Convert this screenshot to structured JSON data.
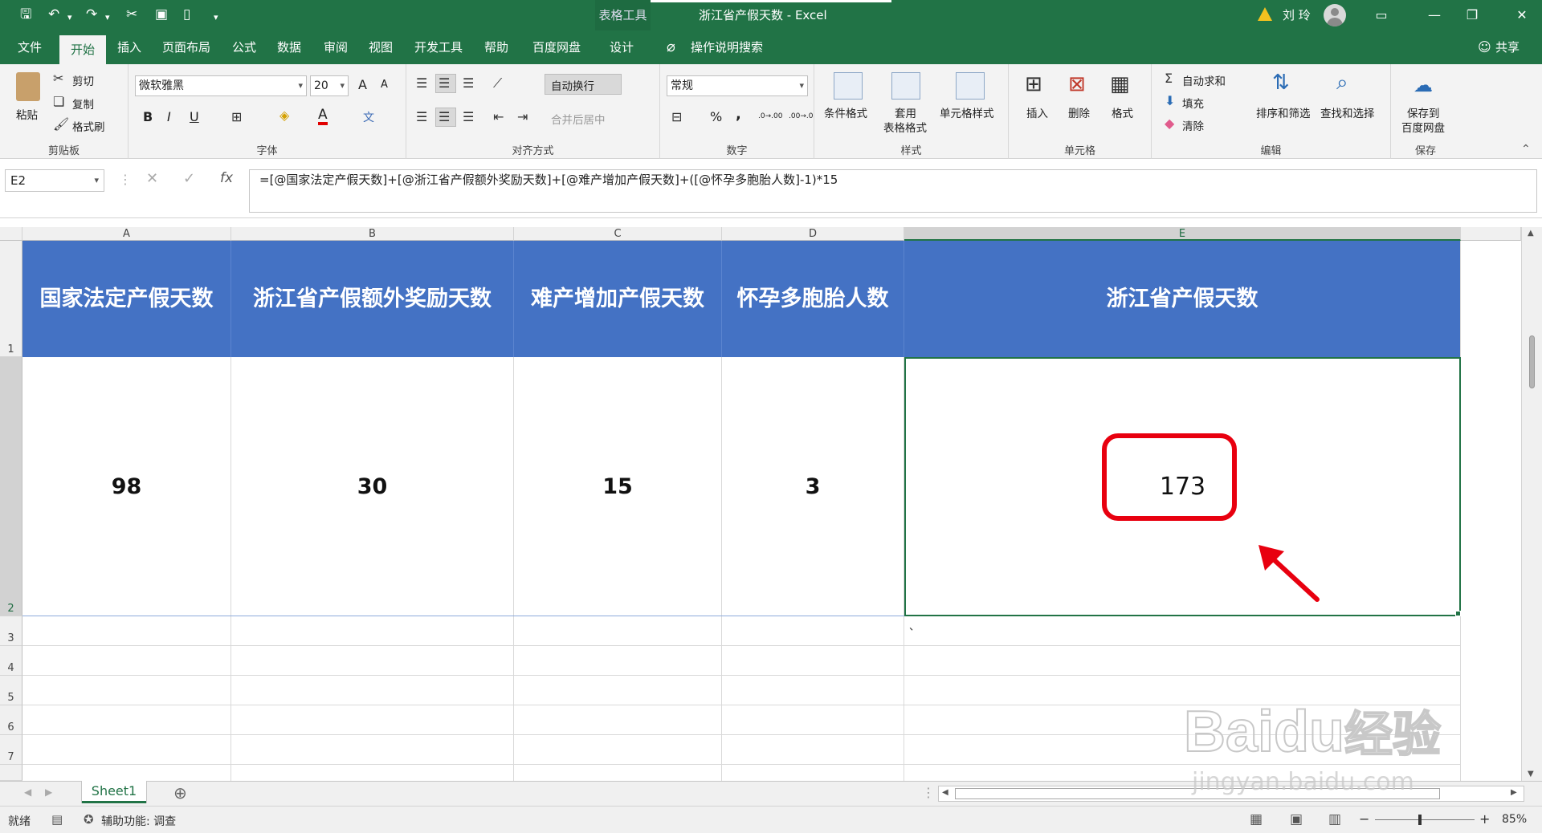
{
  "title_bar": {
    "context_tab": "表格工具",
    "window_title": "浙江省产假天数 - Excel",
    "user_name": "刘 玲",
    "qa_icons": [
      "save-icon",
      "undo-icon",
      "redo-icon",
      "cut-icon",
      "print-preview-icon",
      "new-file-icon",
      "customize-icon"
    ]
  },
  "menu": {
    "tabs": [
      "文件",
      "开始",
      "插入",
      "页面布局",
      "公式",
      "数据",
      "审阅",
      "视图",
      "开发工具",
      "帮助",
      "百度网盘",
      "设计"
    ],
    "active": "开始",
    "tell_me": "操作说明搜索",
    "share": "共享"
  },
  "ribbon": {
    "clipboard": {
      "label": "剪贴板",
      "paste": "粘贴",
      "cut": "剪切",
      "copy": "复制",
      "format_painter": "格式刷"
    },
    "font": {
      "label": "字体",
      "font_name": "微软雅黑",
      "font_size": "20",
      "bold": "B",
      "italic": "I",
      "underline": "U",
      "grow": "A",
      "shrink": "A",
      "font_color_letter": "A",
      "phonetic": "文"
    },
    "alignment": {
      "label": "对齐方式",
      "wrap_text": "自动换行",
      "merge_center": "合并后居中"
    },
    "number": {
      "label": "数字",
      "format": "常规",
      "percent": "%",
      "comma": ",",
      "inc_dec": ".0→.00",
      "dec_dec": ".00→.0"
    },
    "styles": {
      "label": "样式",
      "conditional": "条件格式",
      "table_format_1": "套用",
      "table_format_2": "表格格式",
      "cell_styles": "单元格样式"
    },
    "cells": {
      "label": "单元格",
      "insert": "插入",
      "delete": "删除",
      "format": "格式"
    },
    "editing": {
      "label": "编辑",
      "autosum": "自动求和",
      "fill": "填充",
      "clear": "清除",
      "sort_filter": "排序和筛选",
      "find_select": "查找和选择"
    },
    "save": {
      "label": "保存",
      "save_baidu_1": "保存到",
      "save_baidu_2": "百度网盘"
    }
  },
  "formula_bar": {
    "name_box": "E2",
    "cancel": "✕",
    "enter": "✓",
    "fx": "fx",
    "formula": "=[@国家法定产假天数]+[@浙江省产假额外奖励天数]+[@难产增加产假天数]+([@怀孕多胞胎人数]-1)*15"
  },
  "sheet": {
    "columns": [
      "A",
      "B",
      "C",
      "D",
      "E"
    ],
    "selected_column": "E",
    "rows": [
      "1",
      "2",
      "3",
      "4",
      "5",
      "6",
      "7"
    ],
    "headers": [
      "国家法定产假天数",
      "浙江省产假额外奖励天数",
      "难产增加产假天数",
      "怀孕多胞胎人数",
      "浙江省产假天数"
    ],
    "values": [
      "98",
      "30",
      "15",
      "3",
      "173"
    ],
    "stray_mark": "、"
  },
  "tabs": {
    "sheet_name": "Sheet1",
    "add_sheet": "⊕"
  },
  "status": {
    "ready": "就绪",
    "accessibility": "辅助功能: 调查",
    "zoom": "85%",
    "zoom_minus": "−",
    "zoom_plus": "+"
  },
  "watermark": {
    "text_1": "Bai",
    "text_2": "du",
    "text_3": "经验",
    "url": "jingyan.baidu.com"
  },
  "colors": {
    "excel_green": "#217346",
    "header_blue": "#4472c4",
    "annotation_red": "#e8000f"
  }
}
